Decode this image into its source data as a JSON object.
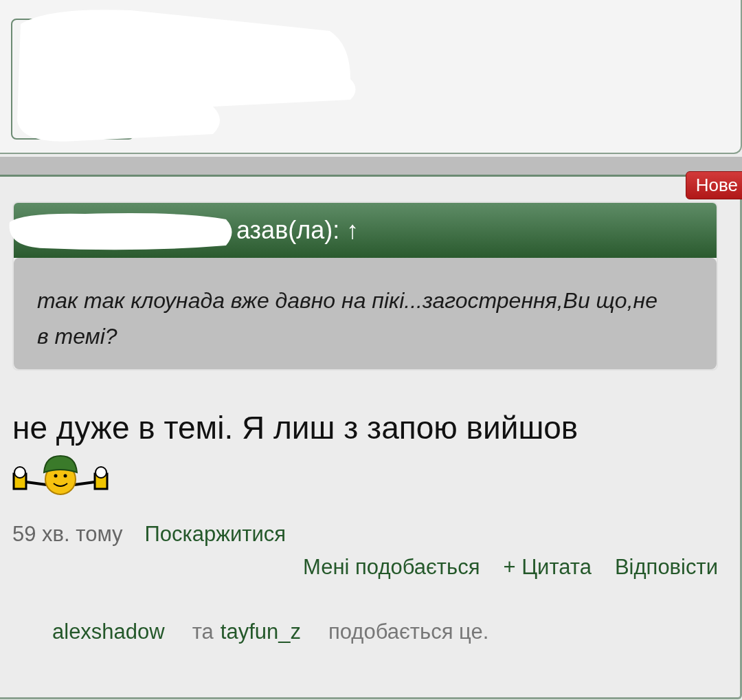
{
  "new_badge": "Нове",
  "quote": {
    "header": "азав(ла): ↑",
    "text": "так так клоунада вже давно на пікі...загострення,Ви що,не в темі?"
  },
  "message": "не дуже в темі. Я лиш з запою вийшов",
  "meta": {
    "time": "59 хв. тому",
    "report": "Поскаржитися"
  },
  "actions": [
    "Мені подобається",
    "+ Цитата",
    "Відповісти"
  ],
  "likes": {
    "users": [
      "alexshadow",
      "tayfun_z"
    ],
    "joiner": "та",
    "suffix": "подобається це."
  }
}
